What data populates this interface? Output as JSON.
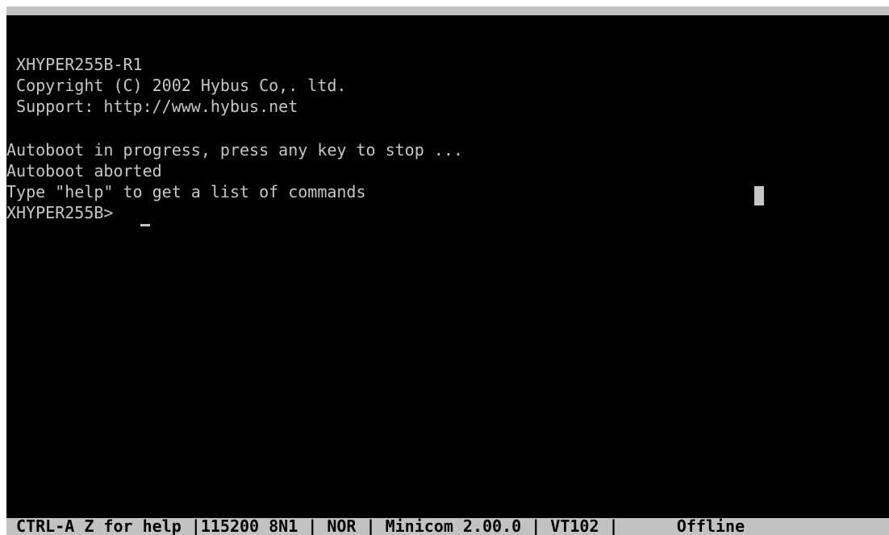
{
  "terminal": {
    "banner_title": " XHYPER255B-R1",
    "copyright": " Copyright (C) 2002 Hybus Co,. ltd.",
    "support": " Support: http://www.hybus.net",
    "autoboot_progress": "Autoboot in progress, press any key to stop ...",
    "autoboot_aborted": "Autoboot aborted",
    "help_hint": "Type \"help\" to get a list of commands",
    "prompt": "XHYPER255B> "
  },
  "status_bar": {
    "text": " CTRL-A Z for help |115200 8N1 | NOR | Minicom 2.00.0 | VT102 |      Offline"
  },
  "colors": {
    "terminal_background": "#000000",
    "terminal_foreground": "#c6c6c6",
    "status_bar_background": "#c2c2c2",
    "status_bar_foreground": "#000000"
  }
}
